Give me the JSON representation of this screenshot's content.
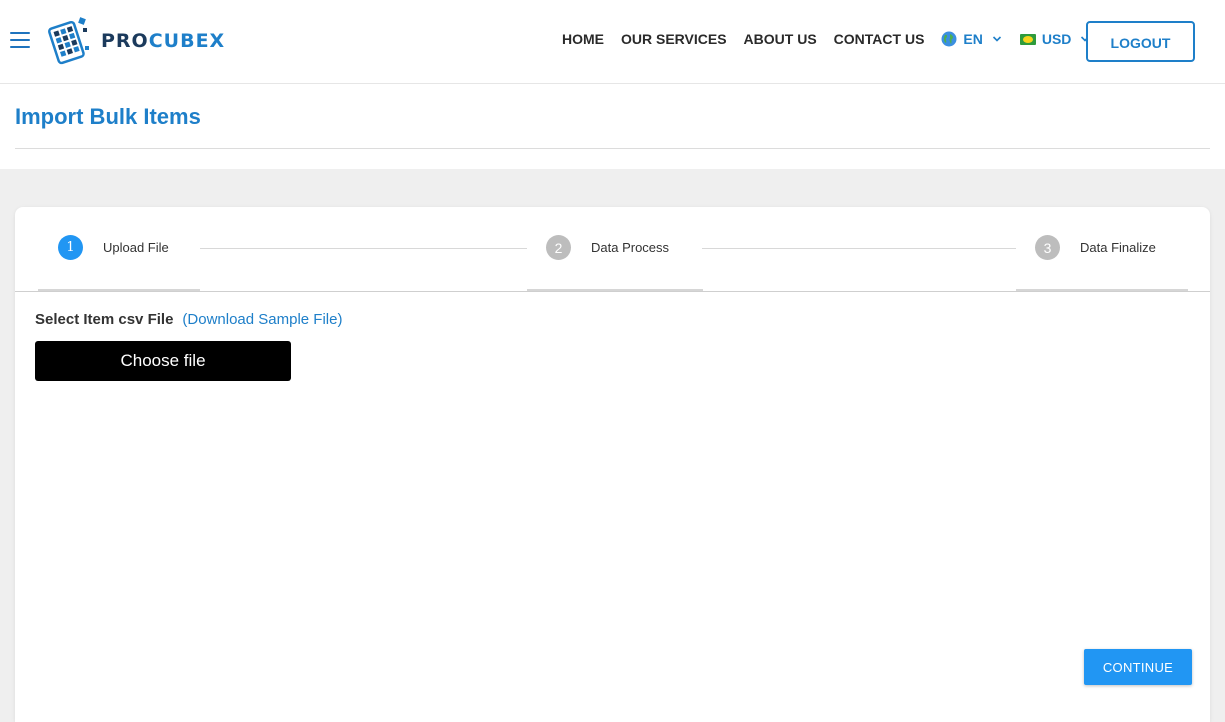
{
  "header": {
    "logo": {
      "part1": "PRO",
      "part2": "CUBEX"
    },
    "nav": [
      "HOME",
      "OUR SERVICES",
      "ABOUT US",
      "CONTACT US"
    ],
    "language": "EN",
    "currency": "USD",
    "logout_label": "LOGOUT"
  },
  "page": {
    "title": "Import Bulk Items"
  },
  "stepper": {
    "steps": [
      {
        "number": "1",
        "label": "Upload File",
        "state": "active"
      },
      {
        "number": "2",
        "label": "Data Process",
        "state": "inactive"
      },
      {
        "number": "3",
        "label": "Data Finalize",
        "state": "inactive"
      }
    ]
  },
  "upload": {
    "label": "Select Item csv File",
    "sample_link": "(Download Sample File)",
    "choose_label": "Choose file"
  },
  "footer": {
    "continue_label": "CONTINUE"
  },
  "colors": {
    "accent": "#1e7fc9",
    "step_active": "#2196f3",
    "step_inactive": "#bdbdbd"
  }
}
